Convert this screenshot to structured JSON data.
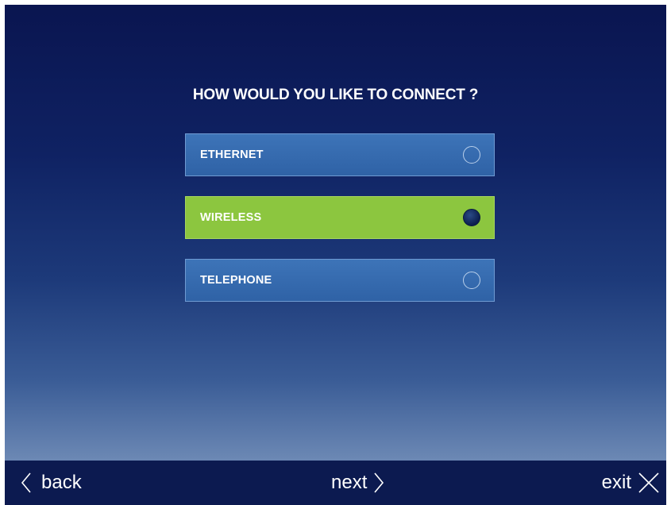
{
  "prompt": {
    "title": "HOW WOULD YOU LIKE TO CONNECT ?"
  },
  "options": [
    {
      "label": "ETHERNET",
      "selected": false
    },
    {
      "label": "WIRELESS",
      "selected": true
    },
    {
      "label": "TELEPHONE",
      "selected": false
    }
  ],
  "footer": {
    "back_label": "back",
    "next_label": "next",
    "exit_label": "exit"
  },
  "icons": {
    "back": "chevron-left-icon",
    "next": "chevron-right-icon",
    "exit": "close-icon",
    "radio": "radio-icon"
  },
  "colors": {
    "selected_option": "#8cc63f",
    "option": "#3569ad",
    "background_top": "#0a1550",
    "footer": "#0c1a50"
  }
}
